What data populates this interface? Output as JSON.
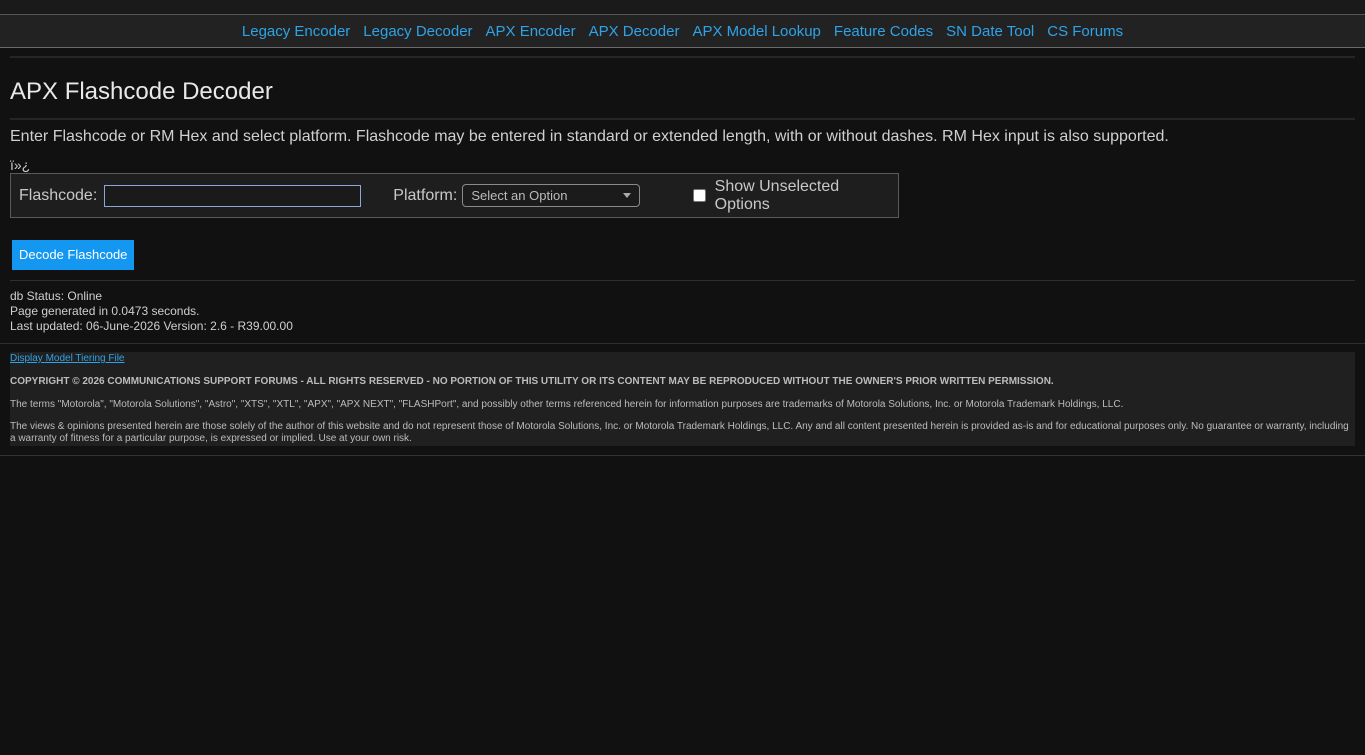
{
  "nav": {
    "items": [
      {
        "label": "Legacy Encoder"
      },
      {
        "label": "Legacy Decoder"
      },
      {
        "label": "APX Encoder"
      },
      {
        "label": "APX Decoder"
      },
      {
        "label": "APX Model Lookup"
      },
      {
        "label": "Feature Codes"
      },
      {
        "label": "SN Date Tool"
      },
      {
        "label": "CS Forums"
      }
    ]
  },
  "page": {
    "title": "APX Flashcode Decoder",
    "intro": "Enter Flashcode or RM Hex and select platform. Flashcode may be entered in standard or extended length, with or without dashes. RM Hex input is also supported.",
    "bom_text": "ï»¿"
  },
  "form": {
    "flashcode_label": "Flashcode:",
    "flashcode_value": "",
    "platform_label": "Platform:",
    "platform_selected": "Select an Option",
    "show_unselected_label": "Show Unselected Options",
    "show_unselected_checked": false,
    "decode_button": "Decode Flashcode"
  },
  "status": {
    "db_status": "db Status: Online",
    "generated": "Page generated in 0.0473 seconds.",
    "last_updated": "Last updated: 06-June-2026 Version: 2.6 - R39.00.00"
  },
  "footer": {
    "tiering_link": "Display Model Tiering File",
    "copyright": "COPYRIGHT © 2026 COMMUNICATIONS SUPPORT FORUMS - ALL RIGHTS RESERVED - NO PORTION OF THIS UTILITY OR ITS CONTENT MAY BE REPRODUCED WITHOUT THE OWNER'S PRIOR WRITTEN PERMISSION.",
    "trademarks": "The terms \"Motorola\", \"Motorola Solutions\", \"Astro\", \"XTS\", \"XTL\", \"APX\", \"APX NEXT\", \"FLASHPort\", and possibly other terms referenced herein for information purposes are trademarks of Motorola Solutions, Inc. or Motorola Trademark Holdings, LLC.",
    "disclaimer": "The views & opinions presented herein are those solely of the author of this website and do not represent those of Motorola Solutions, Inc. or Motorola Trademark Holdings, LLC. Any and all content presented herein is provided as-is and for educational purposes only. No guarantee or warranty, including a warranty of fitness for a particular purpose, is expressed or implied. Use at your own risk."
  },
  "colors": {
    "background": "#111111",
    "link": "#2ea3e8",
    "button": "#1497f0"
  }
}
